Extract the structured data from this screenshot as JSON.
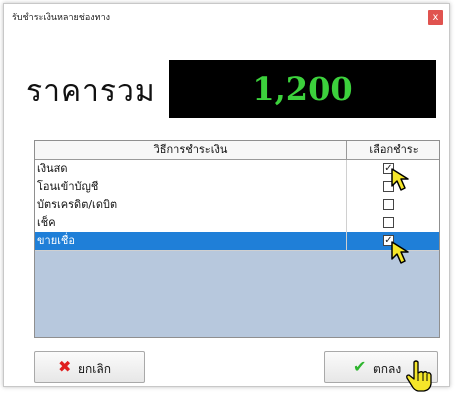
{
  "window": {
    "title": "รับชำระเงินหลายช่องทาง",
    "close_glyph": "x"
  },
  "total": {
    "label": "ราคารวม",
    "value": "1,200"
  },
  "grid": {
    "headers": {
      "method": "วิธีการชำระเงิน",
      "select": "เลือกชำระ"
    },
    "rows": [
      {
        "name": "เงินสด",
        "checked": true,
        "selected": false
      },
      {
        "name": "โอนเข้าบัญชี",
        "checked": false,
        "selected": false
      },
      {
        "name": "บัตรเครดิต/เดบิต",
        "checked": false,
        "selected": false
      },
      {
        "name": "เช็ค",
        "checked": false,
        "selected": false
      },
      {
        "name": "ขายเชื่อ",
        "checked": true,
        "selected": true
      }
    ]
  },
  "buttons": {
    "cancel": {
      "label": "ยกเลิก",
      "icon": "x-icon",
      "icon_color": "#e02020"
    },
    "ok": {
      "label": "ตกลง",
      "icon": "checkmark-icon",
      "icon_color": "#2fb52f"
    }
  },
  "colors": {
    "display_bg": "#000000",
    "display_text": "#3cd13c",
    "selection": "#1f7fd8",
    "grid_empty": "#b7c8dd",
    "close_button": "#e0534f"
  }
}
